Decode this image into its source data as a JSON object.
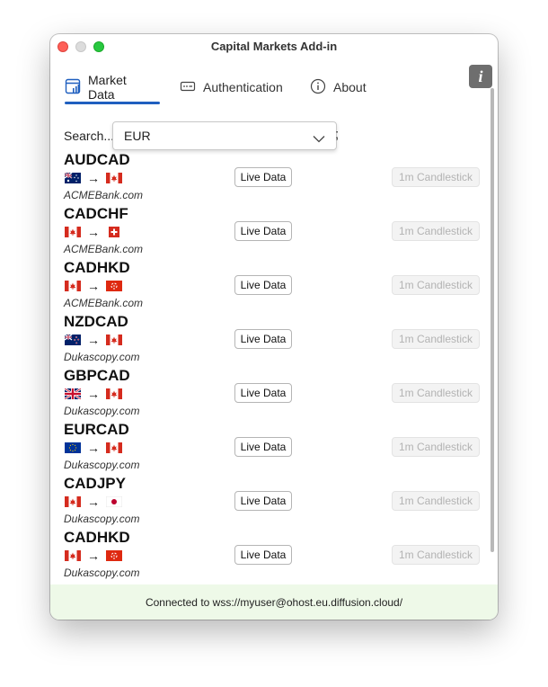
{
  "window": {
    "title": "Capital Markets Add-in"
  },
  "tabs": [
    {
      "label": "Market Data",
      "icon": "market-data-icon",
      "active": true
    },
    {
      "label": "Authentication",
      "icon": "password-icon",
      "active": false
    },
    {
      "label": "About",
      "icon": "info-circle-icon",
      "active": false
    }
  ],
  "info_button": {
    "label": "i"
  },
  "search": {
    "label": "Search...",
    "value": "EUR",
    "trailing": ";"
  },
  "rows": [
    {
      "pair": "AUDCAD",
      "from_flag": "australia-flag",
      "to_flag": "canada-flag",
      "arrow": "→",
      "source": "ACMEBank.com",
      "live_label": "Live Data",
      "candle_label": "1m Candlestick"
    },
    {
      "pair": "CADCHF",
      "from_flag": "canada-flag",
      "to_flag": "switzerland-flag",
      "arrow": "→",
      "source": "ACMEBank.com",
      "live_label": "Live Data",
      "candle_label": "1m Candlestick"
    },
    {
      "pair": "CADHKD",
      "from_flag": "canada-flag",
      "to_flag": "hong-kong-flag",
      "arrow": "→",
      "source": "ACMEBank.com",
      "live_label": "Live Data",
      "candle_label": "1m Candlestick"
    },
    {
      "pair": "NZDCAD",
      "from_flag": "new-zealand-flag",
      "to_flag": "canada-flag",
      "arrow": "→",
      "source": "Dukascopy.com",
      "live_label": "Live Data",
      "candle_label": "1m Candlestick"
    },
    {
      "pair": "GBPCAD",
      "from_flag": "uk-flag",
      "to_flag": "canada-flag",
      "arrow": "→",
      "source": "Dukascopy.com",
      "live_label": "Live Data",
      "candle_label": "1m Candlestick"
    },
    {
      "pair": "EURCAD",
      "from_flag": "eu-flag",
      "to_flag": "canada-flag",
      "arrow": "→",
      "source": "Dukascopy.com",
      "live_label": "Live Data",
      "candle_label": "1m Candlestick"
    },
    {
      "pair": "CADJPY",
      "from_flag": "canada-flag",
      "to_flag": "japan-flag",
      "arrow": "→",
      "source": "Dukascopy.com",
      "live_label": "Live Data",
      "candle_label": "1m Candlestick"
    },
    {
      "pair": "CADHKD",
      "from_flag": "canada-flag",
      "to_flag": "hong-kong-flag",
      "arrow": "→",
      "source": "Dukascopy.com",
      "live_label": "Live Data",
      "candle_label": "1m Candlestick"
    }
  ],
  "status": {
    "text": "Connected to wss://myuser@ohost.eu.diffusion.cloud/"
  },
  "colors": {
    "accent": "#1f5fbf",
    "status_bg": "#eef9e8",
    "info_button": "#6e6e6e"
  }
}
